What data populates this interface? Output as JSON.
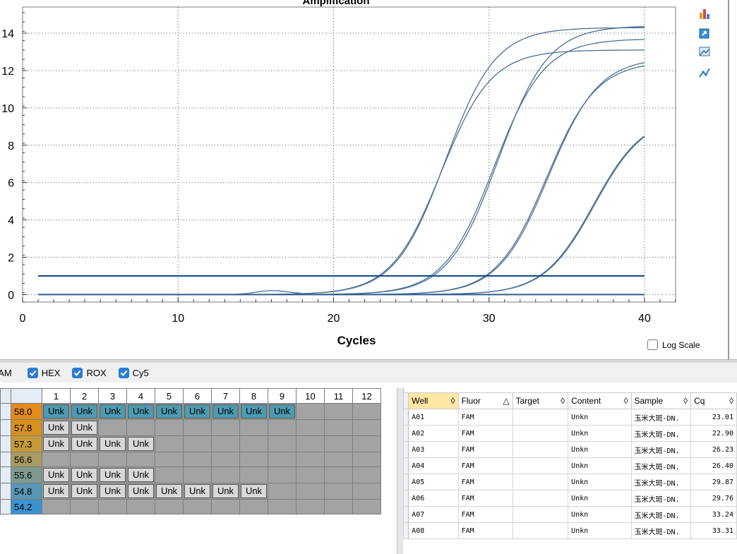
{
  "chart_data": {
    "type": "line",
    "title": "Amplification",
    "xlabel": "Cycles",
    "ylabel": "",
    "xlim": [
      0,
      42
    ],
    "ylim": [
      -0.4,
      15.4
    ],
    "x_ticks": [
      0,
      10,
      20,
      30,
      40
    ],
    "y_ticks": [
      0,
      2,
      4,
      6,
      8,
      10,
      12,
      14
    ],
    "grid": "dotted",
    "threshold": 1.0,
    "series_color": "#4a7099",
    "threshold_color": "#1a4c84",
    "curves": [
      {
        "cq": 23.01,
        "plateau": 14.3
      },
      {
        "cq": 22.9,
        "plateau": 13.1
      },
      {
        "cq": 26.23,
        "plateau": 13.7
      },
      {
        "cq": 26.4,
        "plateau": 14.4
      },
      {
        "cq": 29.87,
        "plateau": 12.7
      },
      {
        "cq": 29.76,
        "plateau": 12.5
      },
      {
        "cq": 33.24,
        "plateau": 9.6
      },
      {
        "cq": 33.31,
        "plateau": 9.6
      }
    ]
  },
  "toolbar_icons": [
    "export-icon",
    "copy-chart-icon",
    "image-icon",
    "line-style-icon"
  ],
  "log_scale_label": "Log Scale",
  "fluors": [
    {
      "label": "FAM",
      "checked": true
    },
    {
      "label": "HEX",
      "checked": true
    },
    {
      "label": "ROX",
      "checked": true
    },
    {
      "label": "Cy5",
      "checked": true
    }
  ],
  "plate": {
    "columns": [
      "1",
      "2",
      "3",
      "4",
      "5",
      "6",
      "7",
      "8",
      "9",
      "10",
      "11",
      "12"
    ],
    "rows": [
      {
        "temp": "58.0",
        "color": "#e38a1c",
        "wells": [
          "Unk",
          "Unk",
          "Unk",
          "Unk",
          "Unk",
          "Unk",
          "Unk",
          "Unk",
          "Unk",
          "",
          "",
          ""
        ],
        "style": "teal"
      },
      {
        "temp": "57.8",
        "color": "#d6901e",
        "wells": [
          "Unk",
          "Unk",
          "",
          "",
          "",
          "",
          "",
          "",
          "",
          "",
          "",
          ""
        ],
        "style": "gray"
      },
      {
        "temp": "57.3",
        "color": "#c69a3a",
        "wells": [
          "Unk",
          "Unk",
          "Unk",
          "Unk",
          "",
          "",
          "",
          "",
          "",
          "",
          "",
          ""
        ],
        "style": "gray"
      },
      {
        "temp": "56.6",
        "color": "#a89a62",
        "wells": [
          "",
          "",
          "",
          "",
          "",
          "",
          "",
          "",
          "",
          "",
          "",
          ""
        ],
        "style": "gray"
      },
      {
        "temp": "55.6",
        "color": "#7e9a8e",
        "wells": [
          "Unk",
          "Unk",
          "Unk",
          "Unk",
          "",
          "",
          "",
          "",
          "",
          "",
          "",
          ""
        ],
        "style": "gray"
      },
      {
        "temp": "54.8",
        "color": "#5797b4",
        "wells": [
          "Unk",
          "Unk",
          "Unk",
          "Unk",
          "Unk",
          "Unk",
          "Unk",
          "Unk",
          "",
          "",
          "",
          ""
        ],
        "style": "gray"
      },
      {
        "temp": "54.2",
        "color": "#3a93cf",
        "wells": [
          "",
          "",
          "",
          "",
          "",
          "",
          "",
          "",
          "",
          "",
          "",
          ""
        ],
        "style": "gray"
      }
    ]
  },
  "table": {
    "headers": [
      {
        "label": "Well",
        "sort": "◊",
        "selected": true
      },
      {
        "label": "Fluor",
        "sort": "△",
        "selected": false
      },
      {
        "label": "Target",
        "sort": "◊",
        "selected": false
      },
      {
        "label": "Content",
        "sort": "◊",
        "selected": false
      },
      {
        "label": "Sample",
        "sort": "◊",
        "selected": false
      },
      {
        "label": "Cq",
        "sort": "◊",
        "selected": false
      }
    ],
    "rows": [
      {
        "well": "A01",
        "fluor": "FAM",
        "target": "",
        "content": "Unkn",
        "sample": "玉米大斑-DN.",
        "cq": "23.01"
      },
      {
        "well": "A02",
        "fluor": "FAM",
        "target": "",
        "content": "Unkn",
        "sample": "玉米大斑-DN.",
        "cq": "22.90"
      },
      {
        "well": "A03",
        "fluor": "FAM",
        "target": "",
        "content": "Unkn",
        "sample": "玉米大斑-DN.",
        "cq": "26.23"
      },
      {
        "well": "A04",
        "fluor": "FAM",
        "target": "",
        "content": "Unkn",
        "sample": "玉米大斑-DN.",
        "cq": "26.40"
      },
      {
        "well": "A05",
        "fluor": "FAM",
        "target": "",
        "content": "Unkn",
        "sample": "玉米大斑-DN.",
        "cq": "29.87"
      },
      {
        "well": "A06",
        "fluor": "FAM",
        "target": "",
        "content": "Unkn",
        "sample": "玉米大斑-DN.",
        "cq": "29.76"
      },
      {
        "well": "A07",
        "fluor": "FAM",
        "target": "",
        "content": "Unkn",
        "sample": "玉米大斑-DN.",
        "cq": "33.24"
      },
      {
        "well": "A08",
        "fluor": "FAM",
        "target": "",
        "content": "Unkn",
        "sample": "玉米大斑-DN.",
        "cq": "33.31"
      }
    ]
  }
}
